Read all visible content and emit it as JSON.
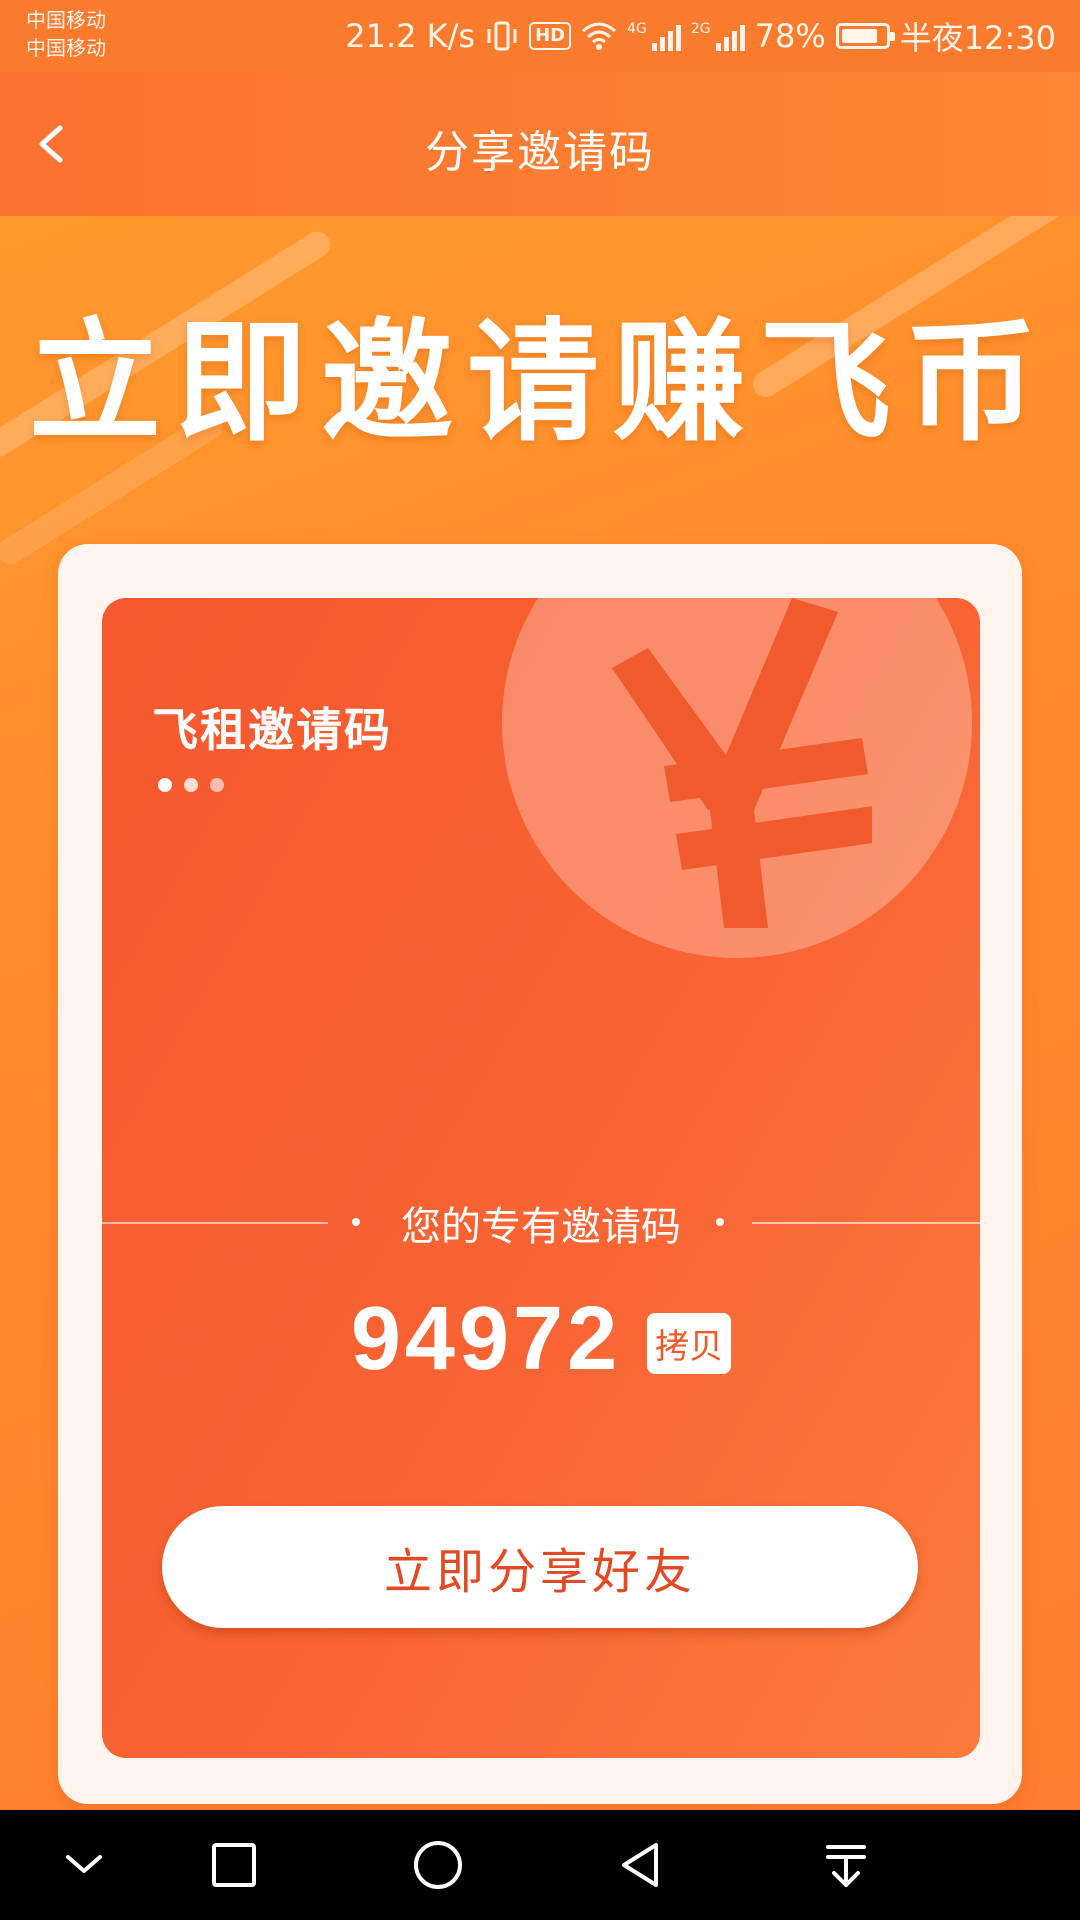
{
  "status_bar": {
    "carrier_1": "中国移动",
    "carrier_2": "中国移动",
    "network_speed": "21.2 K/s",
    "hd_badge": "HD",
    "sim1_type": "4G",
    "sim2_type": "2G",
    "battery": "78%",
    "time": "半夜12:30"
  },
  "header": {
    "title": "分享邀请码",
    "back_icon": "chevron-left-icon"
  },
  "hero": {
    "title": "立即邀请赚飞币"
  },
  "card": {
    "label": "飞租邀请码",
    "exclusive_label": "您的专有邀请码",
    "invite_code": "94972",
    "copy_label": "拷贝",
    "share_label": "立即分享好友",
    "coin_icon": "yuan-icon"
  },
  "nav_bar": {
    "icons": [
      "chevron-down-icon",
      "square-icon",
      "circle-icon",
      "triangle-back-icon",
      "download-icon"
    ]
  },
  "colors": {
    "accent": "#fa7a2e",
    "card": "#f4582c",
    "button_text": "#e24a24"
  }
}
